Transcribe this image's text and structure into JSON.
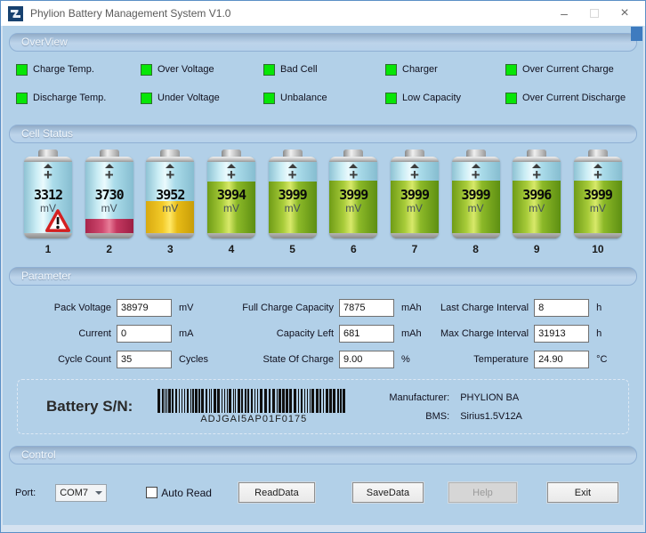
{
  "window": {
    "title": "Phylion Battery Management System V1.0",
    "close_glyph": "×",
    "minimize_glyph": "–"
  },
  "overview": {
    "header": "OverView",
    "indicators": [
      {
        "label": "Charge Temp.",
        "status_color": "#07e607"
      },
      {
        "label": "Over Voltage",
        "status_color": "#07e607"
      },
      {
        "label": "Bad Cell",
        "status_color": "#07e607"
      },
      {
        "label": "Charger",
        "status_color": "#07e607"
      },
      {
        "label": "Over Current Charge",
        "status_color": "#07e607"
      },
      {
        "label": "Discharge Temp.",
        "status_color": "#07e607"
      },
      {
        "label": "Under Voltage",
        "status_color": "#07e607"
      },
      {
        "label": "Unbalance",
        "status_color": "#07e607"
      },
      {
        "label": "Low Capacity",
        "status_color": "#07e607"
      },
      {
        "label": "Over Current Discharge",
        "status_color": "#07e607"
      }
    ]
  },
  "cell_status": {
    "header": "Cell Status",
    "plus_glyph": "+",
    "cells": [
      {
        "num": "1",
        "value": "3312",
        "unit": "mV",
        "fill_percent": 0,
        "fill_color": "",
        "warning": true
      },
      {
        "num": "2",
        "value": "3730",
        "unit": "mV",
        "fill_percent": 24,
        "fill_color": "red",
        "warning": false
      },
      {
        "num": "3",
        "value": "3952",
        "unit": "mV",
        "fill_percent": 46,
        "fill_color": "yellow",
        "warning": false
      },
      {
        "num": "4",
        "value": "3994",
        "unit": "mV",
        "fill_percent": 70,
        "fill_color": "green",
        "warning": false
      },
      {
        "num": "5",
        "value": "3999",
        "unit": "mV",
        "fill_percent": 70,
        "fill_color": "green",
        "warning": false
      },
      {
        "num": "6",
        "value": "3999",
        "unit": "mV",
        "fill_percent": 71,
        "fill_color": "green",
        "warning": false
      },
      {
        "num": "7",
        "value": "3999",
        "unit": "mV",
        "fill_percent": 71,
        "fill_color": "green",
        "warning": false
      },
      {
        "num": "8",
        "value": "3999",
        "unit": "mV",
        "fill_percent": 71,
        "fill_color": "green",
        "warning": false
      },
      {
        "num": "9",
        "value": "3996",
        "unit": "mV",
        "fill_percent": 71,
        "fill_color": "green",
        "warning": false
      },
      {
        "num": "10",
        "value": "3999",
        "unit": "mV",
        "fill_percent": 71,
        "fill_color": "green",
        "warning": false
      }
    ]
  },
  "parameters": {
    "header": "Parameter",
    "fields": [
      {
        "label": "Pack Voltage",
        "value": "38979",
        "unit": "mV"
      },
      {
        "label": "Full Charge Capacity",
        "value": "7875",
        "unit": "mAh"
      },
      {
        "label": "Last Charge Interval",
        "value": "8",
        "unit": "h"
      },
      {
        "label": "Current",
        "value": "0",
        "unit": "mA"
      },
      {
        "label": "Capacity Left",
        "value": "681",
        "unit": "mAh"
      },
      {
        "label": "Max Charge Interval",
        "value": "31913",
        "unit": "h"
      },
      {
        "label": "Cycle Count",
        "value": "35",
        "unit": "Cycles"
      },
      {
        "label": "State Of Charge",
        "value": "9.00",
        "unit": "%"
      },
      {
        "label": "Temperature",
        "value": "24.90",
        "unit": "°C"
      }
    ]
  },
  "sn_panel": {
    "label": "Battery S/N:",
    "serial": "ADJGAI5AP01F0175",
    "manufacturer_label": "Manufacturer:",
    "manufacturer_value": "PHYLION BA",
    "bms_label": "BMS:",
    "bms_value": "Sirius1.5V12A"
  },
  "control": {
    "header": "Control",
    "port_label": "Port:",
    "port_value": "COM7",
    "auto_read_label": "Auto Read",
    "buttons": [
      {
        "label": "ReadData",
        "enabled": true
      },
      {
        "label": "SaveData",
        "enabled": true
      },
      {
        "label": "Help",
        "enabled": false
      },
      {
        "label": "Exit",
        "enabled": true
      }
    ]
  },
  "colors": {
    "indicator_green": "#07e607",
    "fill_red": "#cf3a60",
    "fill_yellow": "#eec41f",
    "fill_green": "#7fb022",
    "client_bg": "#b2d0e8",
    "accent_blue": "#3e7bbf"
  }
}
